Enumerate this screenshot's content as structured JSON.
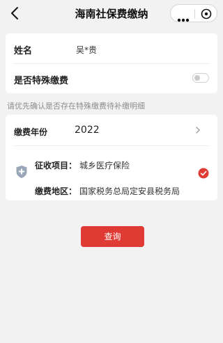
{
  "navbar": {
    "title": "海南社保费缴纳",
    "back_icon": "chevron-left-icon",
    "more_icon": "more-dots-icon",
    "close_icon": "close-circle-icon"
  },
  "form": {
    "name_label": "姓名",
    "name_value": "吴*贵",
    "special_label": "是否特殊缴费",
    "special_enabled": false
  },
  "hint": "请优先确认是否存在特殊缴费待补缴明细",
  "payment": {
    "year_label": "缴费年份",
    "year_value": "2022",
    "item_label": "征收项目：",
    "item_value": "城乡医疗保险",
    "area_label": "缴费地区：",
    "area_value": "国家税务总局定安县税务局",
    "selected": true
  },
  "query_button": "查询",
  "colors": {
    "accent": "#e03a34",
    "background": "#f2f2f2",
    "card": "#ffffff",
    "shield": "#9aa7b8"
  }
}
